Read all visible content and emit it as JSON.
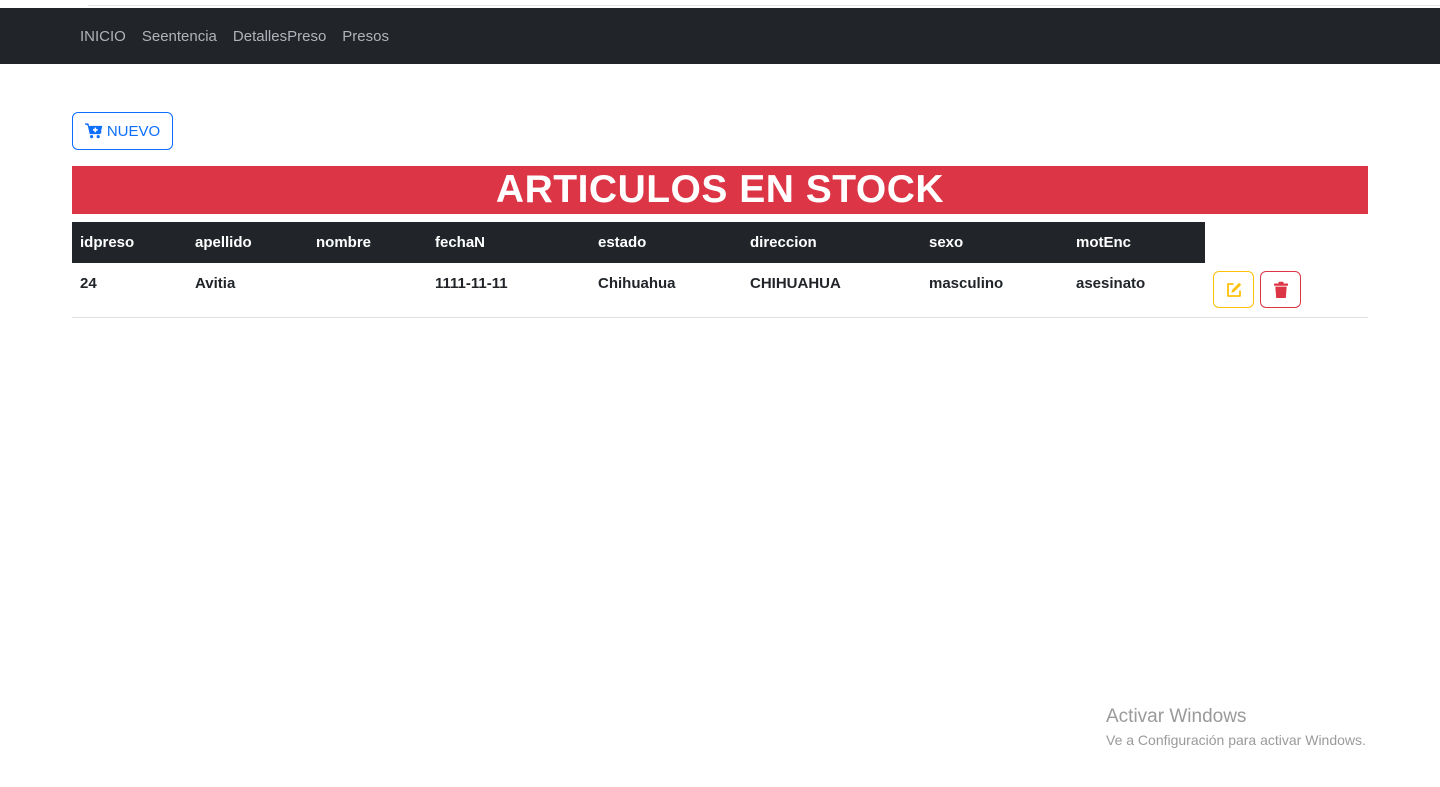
{
  "navbar": {
    "links": [
      "INICIO",
      "Seentencia",
      "DetallesPreso",
      "Presos"
    ]
  },
  "toolbar": {
    "new_button_label": "NUEVO",
    "new_button_icon": "cart-plus-icon"
  },
  "banner": {
    "title": "ARTICULOS EN STOCK"
  },
  "table": {
    "columns": [
      "idpreso",
      "apellido",
      "nombre",
      "fechaN",
      "estado",
      "direccion",
      "sexo",
      "motEnc"
    ],
    "rows": [
      {
        "cells": [
          "24",
          "Avitia",
          "",
          "1111-11-11",
          "Chihuahua",
          "CHIHUAHUA",
          "masculino",
          "asesinato"
        ],
        "actions": [
          "edit-icon",
          "trash-icon"
        ]
      }
    ]
  },
  "watermark": {
    "title": "Activar Windows",
    "subtitle": "Ve a Configuración para activar Windows."
  },
  "colors": {
    "navbar_bg": "#212529",
    "primary": "#0d6efd",
    "danger": "#dc3545",
    "warning": "#ffc107"
  }
}
